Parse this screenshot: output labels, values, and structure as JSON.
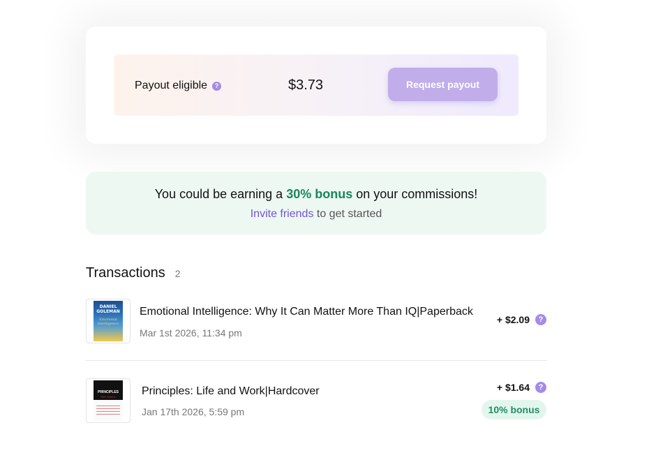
{
  "payout": {
    "label": "Payout eligible",
    "help_icon": "question-mark-icon",
    "amount": "$3.73",
    "request_button": "Request payout"
  },
  "bonus_banner": {
    "prefix": "You could be earning a ",
    "highlight": "30% bonus",
    "suffix": " on your commissions!",
    "invite_link": "Invite friends",
    "invite_suffix": " to get started"
  },
  "transactions": {
    "title": "Transactions",
    "count": "2",
    "items": [
      {
        "cover_author": "DANIEL GOLEMAN",
        "cover_title": "Emotional Intelligence",
        "title": "Emotional Intelligence: Why It Can Matter More Than IQ|Paperback",
        "date": "Mar 1st 2026, 11:34 pm",
        "amount": "+ $2.09"
      },
      {
        "cover_title": "PRINCIPLES",
        "cover_author": "RAY DALIO",
        "title": "Principles: Life and Work|Hardcover",
        "date": "Jan 17th 2026, 5:59 pm",
        "amount": "+ $1.64",
        "badge": "10% bonus"
      }
    ]
  },
  "colors": {
    "accent_purple": "#a58be8",
    "button_purple": "#c0adea",
    "bonus_green": "#18875b",
    "banner_bg": "#eef8f3",
    "link_purple": "#6f55d6"
  }
}
